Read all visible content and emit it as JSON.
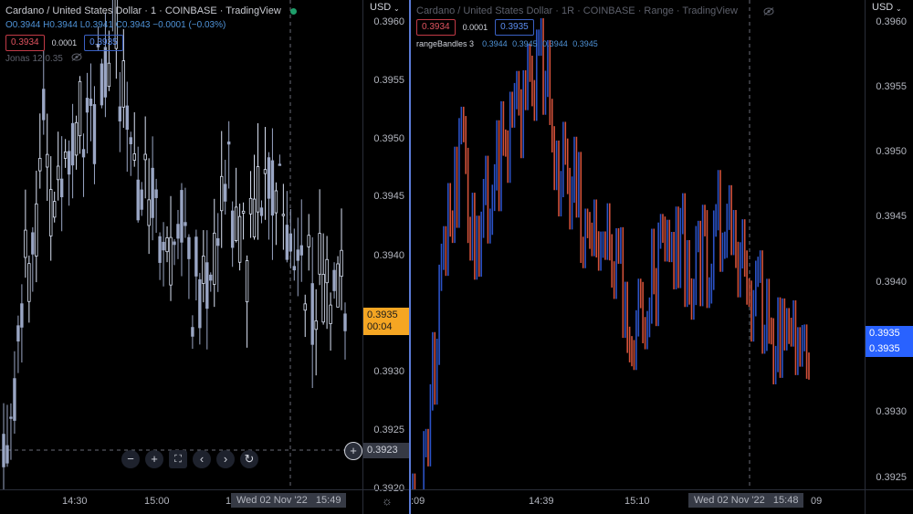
{
  "colors": {
    "up_candle": "#dbe3f5",
    "bid": "#e0535f",
    "ask": "#5b8cf0",
    "pane_separator": "#5b7bd6",
    "current_price_tag": "#f5a623",
    "range_up": "#2b52c6",
    "range_down": "#d2513a"
  },
  "left": {
    "title": "Cardano / United States Dollar · 1 · COINBASE · TradingView",
    "ohlc": "O0.3944 H0.3944 L0.3941 C0.3943 −0.0001 (−0.03%)",
    "bid": "0.3934",
    "spread": "0.0001",
    "ask": "0.3935",
    "indicator": "Jonas 12 0.35",
    "indicator_icon": "eye-off-icon",
    "currency": "USD",
    "price_labels": [
      "0.3960",
      "0.3955",
      "0.3950",
      "0.3945",
      "0.3940",
      "0.3930",
      "0.3925",
      "0.3920"
    ],
    "current_price": "0.3935",
    "countdown": "00:04",
    "crosshair_price": "0.3923",
    "time_labels": [
      "14:30",
      "15:00",
      "1"
    ],
    "crosshair_time": "Wed 02 Nov '22",
    "crosshair_clock": "15:49",
    "toolbar": {
      "zoom_out": "−",
      "zoom_in": "+",
      "reset": "⛶",
      "back": "‹",
      "forward": "›",
      "refresh": "↻"
    }
  },
  "right": {
    "title": "Cardano / United States Dollar · 1R · COINBASE · Range · TradingView",
    "bid": "0.3934",
    "spread": "0.0001",
    "ask": "0.3935",
    "indicator_name": "rangeBandles 3",
    "indicator_values": "0.3944 0.3945 0.3944 0.3945",
    "currency": "USD",
    "price_labels": [
      "0.3960",
      "0.3955",
      "0.3950",
      "0.3945",
      "0.3940",
      "0.3930",
      "0.3925"
    ],
    "ask_tag": "0.3935",
    "bid_tag": "0.3935",
    "time_labels": [
      ":09",
      "14:39",
      "15:10",
      "09"
    ],
    "crosshair_time": "Wed 02 Nov '22",
    "crosshair_clock": "15:48"
  },
  "settings_icon": "gear-icon"
}
